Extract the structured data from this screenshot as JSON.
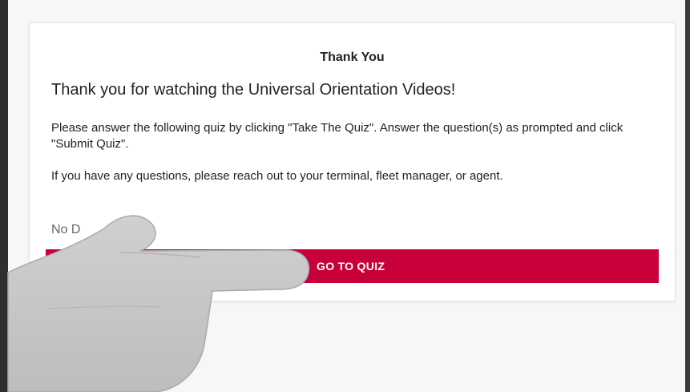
{
  "card": {
    "title": "Thank You",
    "headline": "Thank you for watching the Universal Orientation Videos!",
    "instructions": "Please answer the following quiz by clicking \"Take The Quiz\". Answer the question(s) as prompted and click \"Submit Quiz\".",
    "contact": "If you have any questions, please reach out to your terminal, fleet manager, or agent.",
    "checkbox_label": "No D",
    "button_label": "GO TO QUIZ"
  },
  "colors": {
    "accent": "#c8003a",
    "card_background": "#ffffff",
    "page_background": "#f7f7f7",
    "text": "#222222",
    "muted_text": "#666666",
    "hand": "#c9c9c9"
  },
  "icons": {
    "pointer": "pointing-hand-icon"
  }
}
